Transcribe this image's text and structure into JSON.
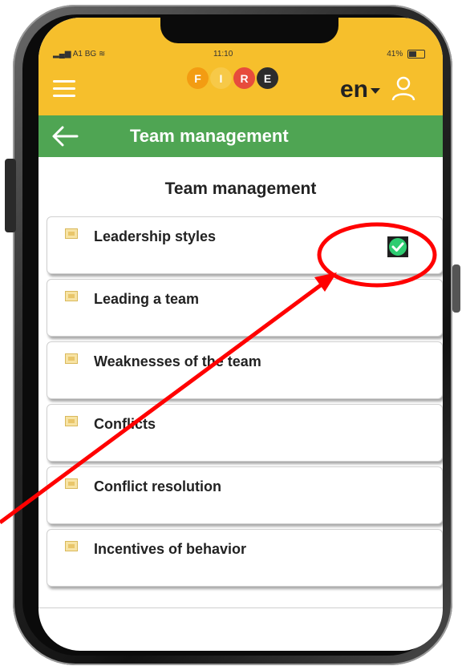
{
  "status_bar": {
    "carrier": "A1 BG",
    "time": "11:10",
    "battery": "41%"
  },
  "header": {
    "logo_letters": [
      "F",
      "I",
      "R",
      "E"
    ],
    "logo_colors": [
      "#f39c12",
      "#f7c948",
      "#e74c3c",
      "#2c2c2c"
    ],
    "language": "en"
  },
  "title_bar": {
    "title": "Team management"
  },
  "content": {
    "section_title": "Team management",
    "lessons": [
      {
        "label": "Leadership styles",
        "completed": true
      },
      {
        "label": "Leading a team",
        "completed": false
      },
      {
        "label": "Weaknesses of the team",
        "completed": false
      },
      {
        "label": "Conflicts",
        "completed": false
      },
      {
        "label": "Conflict resolution",
        "completed": false
      },
      {
        "label": "Incentives of behavior",
        "completed": false
      }
    ]
  },
  "colors": {
    "header_yellow": "#f6bf2c",
    "title_green": "#4fa553",
    "check_green": "#2ecc71",
    "annotation_red": "#ff0000"
  },
  "icons": [
    "menu-icon",
    "user-icon",
    "back-arrow-icon",
    "lesson-icon",
    "check-icon"
  ]
}
